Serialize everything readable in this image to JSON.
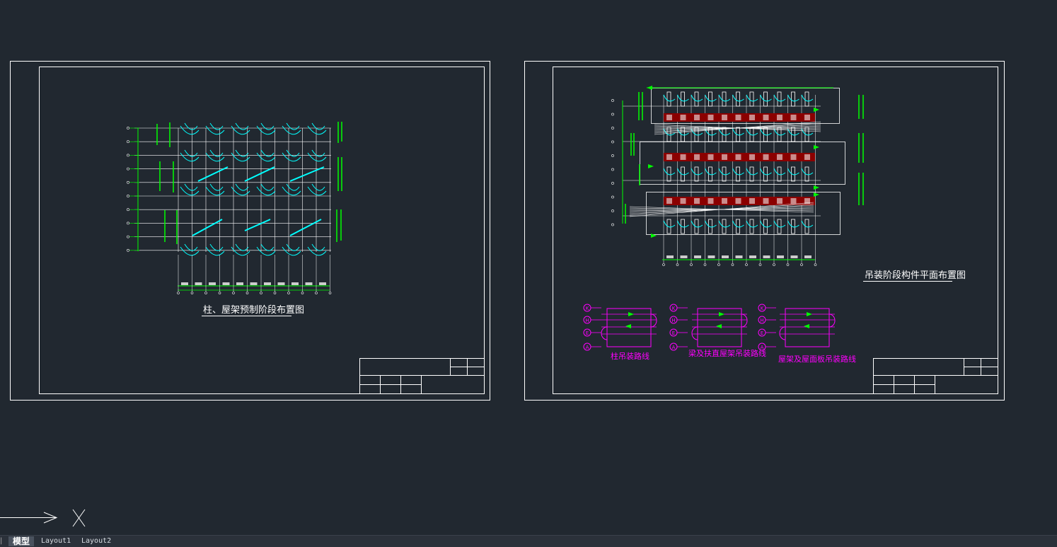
{
  "app": {
    "colors": {
      "background": "#212830",
      "frame": "#ffffff",
      "grid": "#ffffff",
      "dim": "#00ff00",
      "member": "#00ffff",
      "route": "#ff00ff",
      "hatch": "#8b0000",
      "text": "#ffffff"
    }
  },
  "drawings": {
    "left_title": "柱、屋架预制阶段布置图",
    "right_title": "吊装阶段构件平面布置图",
    "route_labels": [
      "柱吊装路线",
      "梁及扶直屋架吊装路线",
      "屋架及屋面板吊装路线"
    ],
    "axis_letters": [
      "K",
      "H",
      "E",
      "A"
    ]
  },
  "tabs": {
    "model": "模型",
    "layout1": "Layout1",
    "layout2": "Layout2"
  }
}
